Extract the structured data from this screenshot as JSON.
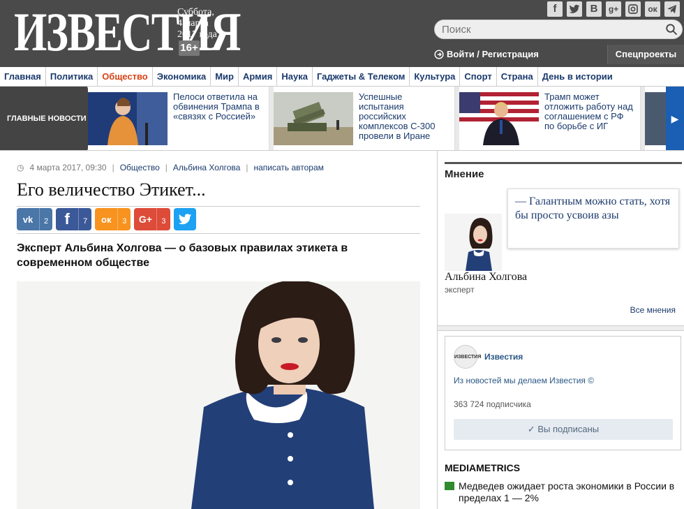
{
  "header": {
    "logo": "ИЗВЕСТИЯ",
    "date_line1": "Суббота,",
    "date_line2": "4 марта",
    "date_line3": "2017 года",
    "age_badge": "16+",
    "search_placeholder": "Поиск",
    "login_label": "Войти / Регистрация",
    "special_label": "Спецпроекты",
    "socials": [
      "f",
      "t",
      "В",
      "g+",
      "ig",
      "ок",
      "tg"
    ]
  },
  "nav": {
    "items": [
      "Главная",
      "Политика",
      "Общество",
      "Экономика",
      "Мир",
      "Армия",
      "Наука",
      "Гаджеты & Телеком",
      "Культура",
      "Спорт",
      "Страна",
      "День в истории"
    ],
    "active": "Общество"
  },
  "strip": {
    "label": "ГЛАВНЫЕ НОВОСТИ",
    "stories": [
      {
        "text": "Пелоси ответила на обвинения Трампа в «связях с Россией»"
      },
      {
        "text": "Успешные испытания российских комплексов С-300 провели в Иране"
      },
      {
        "text": "Трамп может отложить работу над соглашением с РФ по борьбе с ИГ"
      }
    ]
  },
  "article": {
    "date": "4 марта 2017, 09:30",
    "section": "Общество",
    "author": "Альбина Холгова",
    "write_link": "написать авторам",
    "title": "Его величество Этикет...",
    "lead": "Эксперт Альбина Холгова — о базовых правилах этикета в современном обществе",
    "shares": [
      {
        "icon": "vk",
        "label": "vk",
        "count": "2",
        "color": "#4a76a8"
      },
      {
        "icon": "fb",
        "label": "f",
        "count": "7",
        "color": "#3b5998"
      },
      {
        "icon": "ok",
        "label": "ок",
        "count": "3",
        "color": "#f7931e"
      },
      {
        "icon": "gplus",
        "label": "G+",
        "count": "3",
        "color": "#dd4b39"
      },
      {
        "icon": "twitter",
        "label": "t",
        "count": "",
        "color": "#1da1f2"
      }
    ]
  },
  "opinion": {
    "heading": "Мнение",
    "quote": "— Галантным можно стать, хотя бы просто усвоив азы",
    "name": "Альбина Холгова",
    "role": "эксперт",
    "all_link": "Все мнения"
  },
  "vk_widget": {
    "logo_text": "ИЗВЕСТИЯ",
    "name": "Известия",
    "description": "Из новостей мы делаем Известия ©",
    "subscribers": "363 724 подписчика",
    "button": "✓ Вы подписаны"
  },
  "mediametrics": {
    "heading": "MEDIAMETRICS",
    "item": "Медведев ожидает роста экономики в России в пределах 1 — 2%"
  }
}
